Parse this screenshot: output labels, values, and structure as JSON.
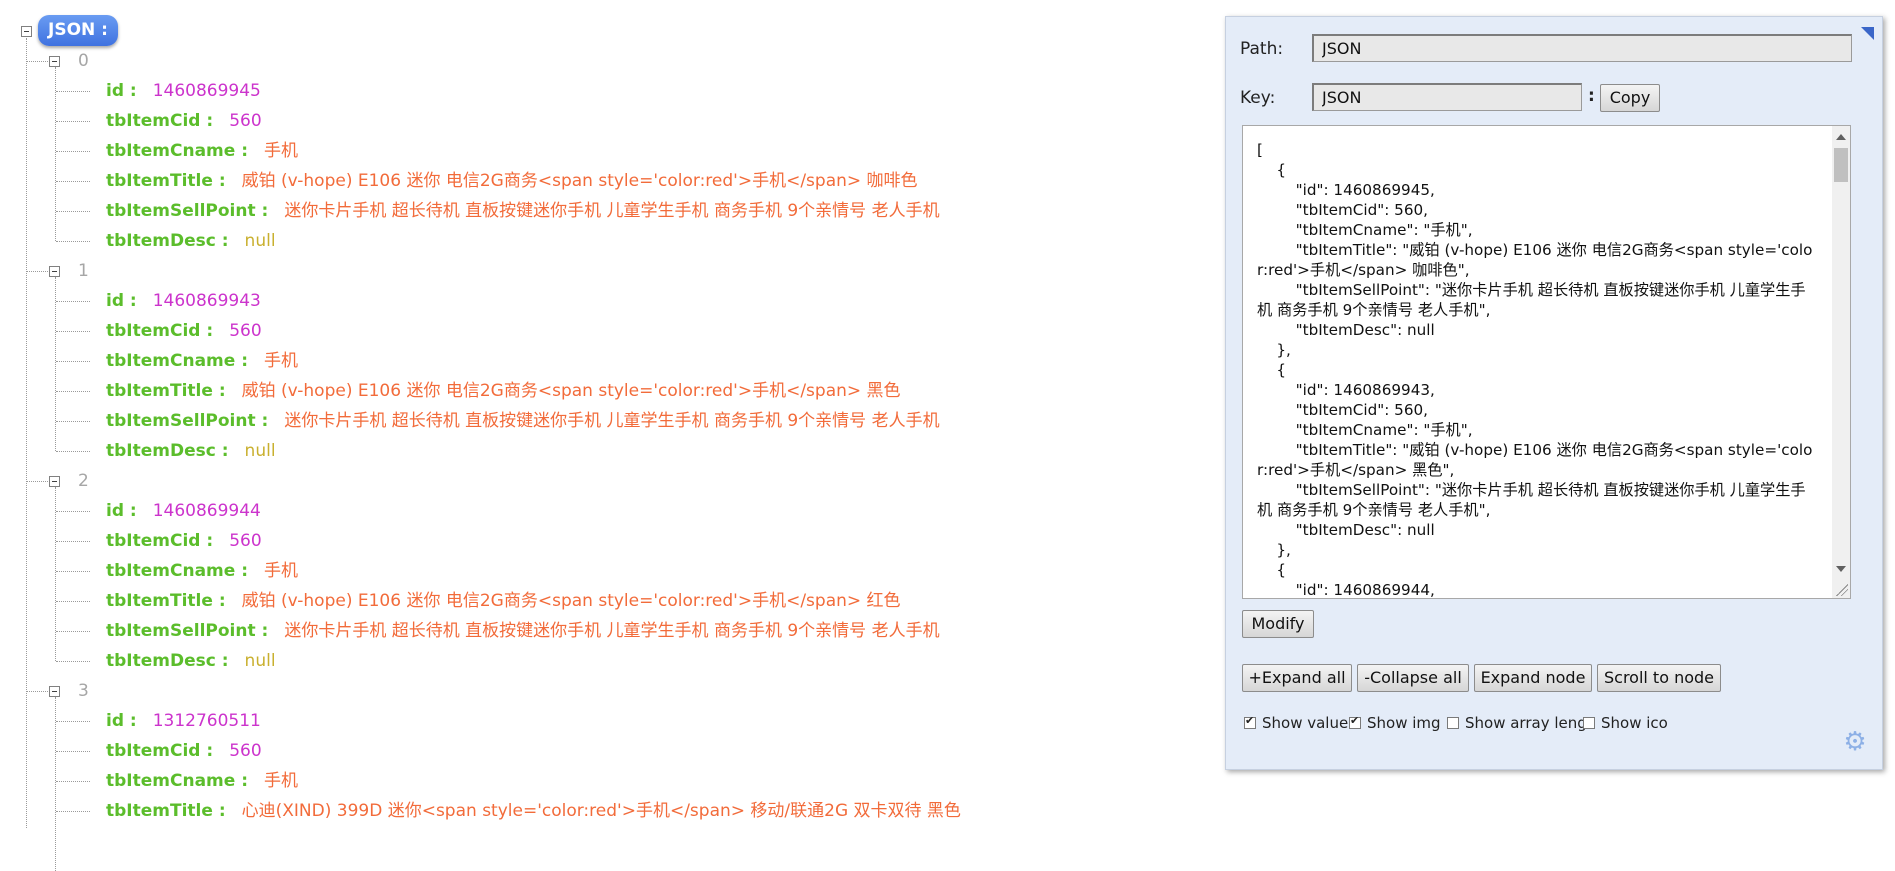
{
  "root_label": "JSON :",
  "items": [
    {
      "index": "0",
      "fields": [
        {
          "key": "id :",
          "value": "1460869945",
          "type": "num"
        },
        {
          "key": "tbItemCid :",
          "value": "560",
          "type": "num"
        },
        {
          "key": "tbItemCname :",
          "value": "手机",
          "type": "str"
        },
        {
          "key": "tbItemTitle :",
          "value": "威铂 (v-hope) E106 迷你 电信2G商务<span style='color:red'>手机</span> 咖啡色",
          "type": "str"
        },
        {
          "key": "tbItemSellPoint :",
          "value": "迷你卡片手机 超长待机 直板按键迷你手机 儿童学生手机 商务手机 9个亲情号 老人手机",
          "type": "str"
        },
        {
          "key": "tbItemDesc :",
          "value": "null",
          "type": "null"
        }
      ]
    },
    {
      "index": "1",
      "fields": [
        {
          "key": "id :",
          "value": "1460869943",
          "type": "num"
        },
        {
          "key": "tbItemCid :",
          "value": "560",
          "type": "num"
        },
        {
          "key": "tbItemCname :",
          "value": "手机",
          "type": "str"
        },
        {
          "key": "tbItemTitle :",
          "value": "威铂 (v-hope) E106 迷你 电信2G商务<span style='color:red'>手机</span> 黑色",
          "type": "str"
        },
        {
          "key": "tbItemSellPoint :",
          "value": "迷你卡片手机 超长待机 直板按键迷你手机 儿童学生手机 商务手机 9个亲情号 老人手机",
          "type": "str"
        },
        {
          "key": "tbItemDesc :",
          "value": "null",
          "type": "null"
        }
      ]
    },
    {
      "index": "2",
      "fields": [
        {
          "key": "id :",
          "value": "1460869944",
          "type": "num"
        },
        {
          "key": "tbItemCid :",
          "value": "560",
          "type": "num"
        },
        {
          "key": "tbItemCname :",
          "value": "手机",
          "type": "str"
        },
        {
          "key": "tbItemTitle :",
          "value": "威铂 (v-hope) E106 迷你 电信2G商务<span style='color:red'>手机</span> 红色",
          "type": "str"
        },
        {
          "key": "tbItemSellPoint :",
          "value": "迷你卡片手机 超长待机 直板按键迷你手机 儿童学生手机 商务手机 9个亲情号 老人手机",
          "type": "str"
        },
        {
          "key": "tbItemDesc :",
          "value": "null",
          "type": "null"
        }
      ]
    },
    {
      "index": "3",
      "fields": [
        {
          "key": "id :",
          "value": "1312760511",
          "type": "num"
        },
        {
          "key": "tbItemCid :",
          "value": "560",
          "type": "num"
        },
        {
          "key": "tbItemCname :",
          "value": "手机",
          "type": "str"
        },
        {
          "key": "tbItemTitle :",
          "value": "心迪(XIND) 399D 迷你<span style='color:red'>手机</span> 移动/联通2G 双卡双待 黑色",
          "type": "str"
        }
      ]
    }
  ],
  "panel": {
    "path_label": "Path:",
    "path_value": "JSON",
    "key_label": "Key:",
    "key_value": "JSON",
    "key_colon": ":",
    "copy_label": "Copy",
    "json_text": "[\n    {\n        \"id\": 1460869945,\n        \"tbItemCid\": 560,\n        \"tbItemCname\": \"手机\",\n        \"tbItemTitle\": \"威铂 (v-hope) E106 迷你 电信2G商务<span style='color:red'>手机</span> 咖啡色\",\n        \"tbItemSellPoint\": \"迷你卡片手机 超长待机 直板按键迷你手机 儿童学生手机 商务手机 9个亲情号 老人手机\",\n        \"tbItemDesc\": null\n    },\n    {\n        \"id\": 1460869943,\n        \"tbItemCid\": 560,\n        \"tbItemCname\": \"手机\",\n        \"tbItemTitle\": \"威铂 (v-hope) E106 迷你 电信2G商务<span style='color:red'>手机</span> 黑色\",\n        \"tbItemSellPoint\": \"迷你卡片手机 超长待机 直板按键迷你手机 儿童学生手机 商务手机 9个亲情号 老人手机\",\n        \"tbItemDesc\": null\n    },\n    {\n        \"id\": 1460869944,",
    "modify_label": "Modify",
    "expand_all_label": "+Expand all",
    "collapse_all_label": "-Collapse all",
    "expand_node_label": "Expand node",
    "scroll_to_node_label": "Scroll to node",
    "checkboxes": [
      {
        "label": "Show value",
        "checked": true
      },
      {
        "label": "Show img",
        "checked": true
      },
      {
        "label": "Show array leng",
        "checked": false
      },
      {
        "label": "Show ico",
        "checked": false
      }
    ],
    "gear_icon": "gear-icon"
  },
  "colors": {
    "key": "#5bbd2b",
    "number": "#cc33cc",
    "string": "#f26b3a",
    "null": "#c9b02f",
    "index": "#a6a6a6",
    "root_badge": "#3f72e0",
    "panel_bg": "#e4ecf8"
  }
}
